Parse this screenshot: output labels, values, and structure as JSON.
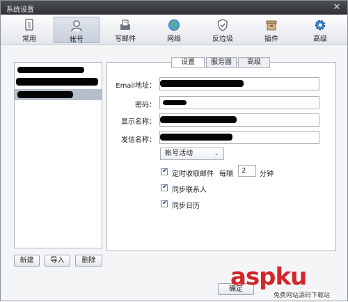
{
  "window": {
    "title": "系统设置",
    "close_glyph": "✕"
  },
  "toolbar": {
    "items": [
      {
        "label": "常用",
        "icon": "document-icon"
      },
      {
        "label": "帐号",
        "icon": "user-icon"
      },
      {
        "label": "写邮件",
        "icon": "compose-icon"
      },
      {
        "label": "网络",
        "icon": "globe-icon"
      },
      {
        "label": "反垃圾",
        "icon": "shield-icon"
      },
      {
        "label": "插件",
        "icon": "box-icon"
      },
      {
        "label": "高级",
        "icon": "gear-icon"
      }
    ],
    "active": "帐号"
  },
  "tabs": [
    {
      "label": "设置",
      "active": true
    },
    {
      "label": "服务器",
      "active": false
    },
    {
      "label": "高级",
      "active": false
    }
  ],
  "form": {
    "email_label": "Email地址：",
    "password_label": "密码：",
    "display_name_label": "显示名称：",
    "sender_name_label": "发信名称：",
    "account_activity": "帐号活动",
    "auto_receive_label": "定时收取邮件",
    "every_label": "每隔",
    "interval_value": "2",
    "minutes_label": "分钟",
    "sync_contacts_label": "同步联系人",
    "sync_calendar_label": "同步日历"
  },
  "left_buttons": {
    "new": "新建",
    "import": "导入",
    "delete": "删除"
  },
  "footer": {
    "ok": "确定"
  },
  "watermark": {
    "brand_a": "asp",
    "brand_b": "ku",
    "sub": "免费网站源码下载站"
  },
  "colors": {
    "accent": "#1a56b0",
    "selected_row": "#b6bfcc",
    "watermark": "#d3262a"
  }
}
